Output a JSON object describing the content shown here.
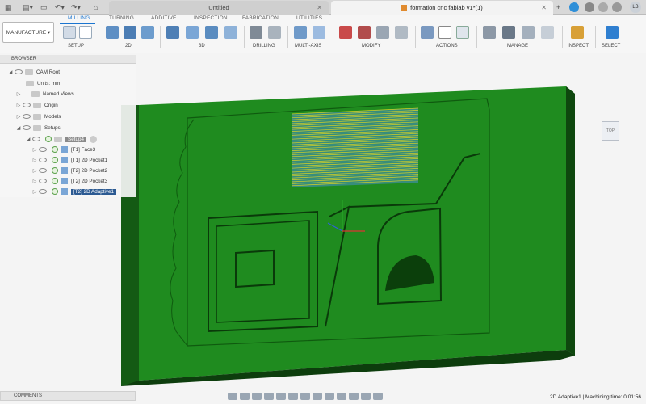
{
  "window": {
    "tab_untitled": "Untitled",
    "tab_active": "formation cnc fablab v1*(1)",
    "avatar": "LB"
  },
  "ribbon": {
    "workspace": "MANUFACTURE",
    "tabs": [
      "MILLING",
      "TURNING",
      "ADDITIVE",
      "INSPECTION",
      "FABRICATION",
      "UTILITIES"
    ],
    "groups": [
      "SETUP",
      "2D",
      "3D",
      "DRILLING",
      "MULTI-AXIS",
      "MODIFY",
      "ACTIONS",
      "MANAGE",
      "INSPECT",
      "SELECT"
    ]
  },
  "browser": {
    "title": "BROWSER",
    "root": "CAM Root",
    "units": "Units: mm",
    "named_views": "Named Views",
    "origin": "Origin",
    "models": "Models",
    "setups": "Setups",
    "setup": "Setup4",
    "operations": [
      "[T1] Face3",
      "[T1] 2D Pocket1",
      "[T2] 2D Pocket2",
      "[T2] 2D Pocket3",
      "[T2] 2D Adaptive1"
    ]
  },
  "viewcube": {
    "label": "TOP"
  },
  "bottom": {
    "comments": "COMMENTS",
    "status": "2D Adaptive1 | Machining time: 0:01:56"
  },
  "colors": {
    "stock_top": "#1f8b1f",
    "stock_side": "#0d3d0d",
    "toolpath": "#d8d224",
    "accent": "#1b75d0"
  }
}
